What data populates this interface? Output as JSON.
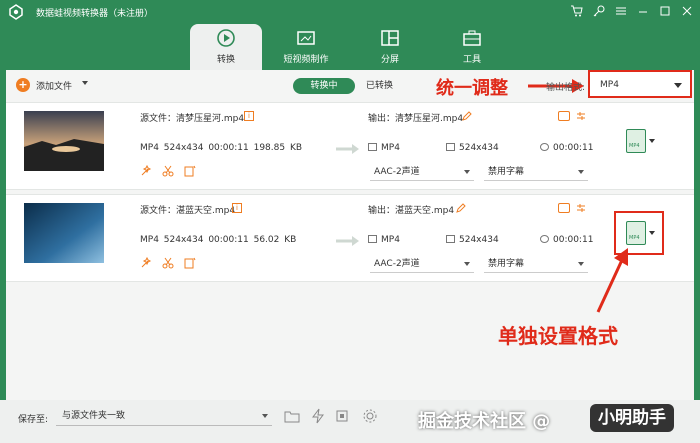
{
  "app": {
    "title": "数据蛙视频转换器（未注册）"
  },
  "tabs": [
    {
      "label": "转换",
      "icon": "convert-icon",
      "active": true
    },
    {
      "label": "短视频制作",
      "icon": "video-make-icon",
      "active": false
    },
    {
      "label": "分屏",
      "icon": "split-screen-icon",
      "active": false
    },
    {
      "label": "工具",
      "icon": "toolbox-icon",
      "active": false
    }
  ],
  "toolbar": {
    "add_file": "添加文件",
    "converting": "转换中",
    "converted": "已转换",
    "convert_all_label": "输出格式:",
    "convert_all_value": "MP4"
  },
  "annotations": {
    "top": "统一调整",
    "bottom": "单独设置格式"
  },
  "files": [
    {
      "source": "源文件：清梦压星河.mp4",
      "meta": "MP4   524x434   00:00:11   198.85 KB",
      "output": "输出：清梦压星河.mp4",
      "out_format": "MP4",
      "out_res": "524x434",
      "out_time": "00:00:11",
      "audio": "AAC-2声道",
      "subtitle": "禁用字幕",
      "format_badge": "MP4"
    },
    {
      "source": "源文件：湛蓝天空.mp4",
      "meta": "MP4   524x434   00:00:11   56.02 KB",
      "output": "输出：湛蓝天空.mp4",
      "out_format": "MP4",
      "out_res": "524x434",
      "out_time": "00:00:11",
      "audio": "AAC-2声道",
      "subtitle": "禁用字幕",
      "format_badge": "MP4"
    }
  ],
  "bottom": {
    "save_label": "保存至:",
    "save_value": "与源文件夹一致"
  },
  "watermark": {
    "text": "掘金技术社区 @",
    "badge": "小明助手"
  },
  "colors": {
    "brand": "#2f8a57",
    "accent": "#ef7d22",
    "annotation": "#e02b1a"
  }
}
